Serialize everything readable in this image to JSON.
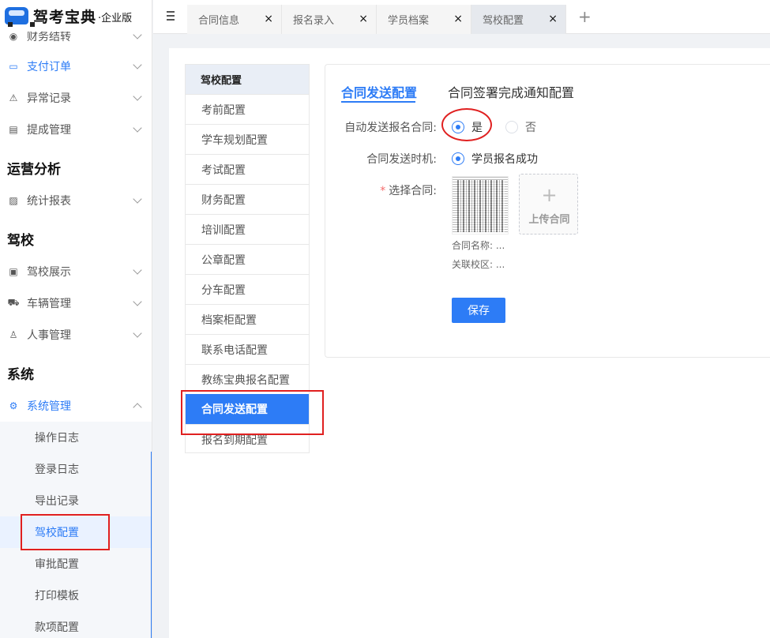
{
  "logo": {
    "name": "驾考宝典",
    "edition": "·企业版"
  },
  "sidebar": {
    "items": [
      {
        "label": "财务结转"
      },
      {
        "label": "支付订单"
      },
      {
        "label": "异常记录"
      },
      {
        "label": "提成管理"
      }
    ],
    "sections": [
      "运营分析",
      "驾校",
      "系统"
    ],
    "analysis_items": [
      {
        "label": "统计报表"
      }
    ],
    "school_items": [
      {
        "label": "驾校展示"
      },
      {
        "label": "车辆管理"
      },
      {
        "label": "人事管理"
      }
    ],
    "system_items": [
      {
        "label": "系统管理"
      }
    ],
    "system_sub": [
      {
        "label": "操作日志"
      },
      {
        "label": "登录日志"
      },
      {
        "label": "导出记录"
      },
      {
        "label": "驾校配置"
      },
      {
        "label": "审批配置"
      },
      {
        "label": "打印模板"
      },
      {
        "label": "款项配置"
      }
    ]
  },
  "tabs": [
    {
      "label": "合同信息"
    },
    {
      "label": "报名录入"
    },
    {
      "label": "学员档案"
    },
    {
      "label": "驾校配置"
    }
  ],
  "tab_close": "×",
  "tab_add": "+",
  "config_nav": {
    "head": "驾校配置",
    "items": [
      "考前配置",
      "学车规划配置",
      "考试配置",
      "财务配置",
      "培训配置",
      "公章配置",
      "分车配置",
      "档案柜配置",
      "联系电话配置",
      "教练宝典报名配置",
      "合同发送配置",
      "报名到期配置"
    ]
  },
  "content": {
    "tabs": [
      "合同发送配置",
      "合同签署完成通知配置"
    ],
    "auto_send_label": "自动发送报名合同:",
    "auto_send_yes": "是",
    "auto_send_no": "否",
    "send_time_label": "合同发送时机:",
    "send_time_option": "学员报名成功",
    "required_mark": "*",
    "select_contract_label": "选择合同:",
    "upload_plus": "+",
    "upload_text": "上传合同",
    "contract_name": "合同名称: ...",
    "campus": "关联校区: ...",
    "save": "保存"
  },
  "colors": {
    "accent": "#2d7cf6",
    "annotation": "#e02020"
  }
}
